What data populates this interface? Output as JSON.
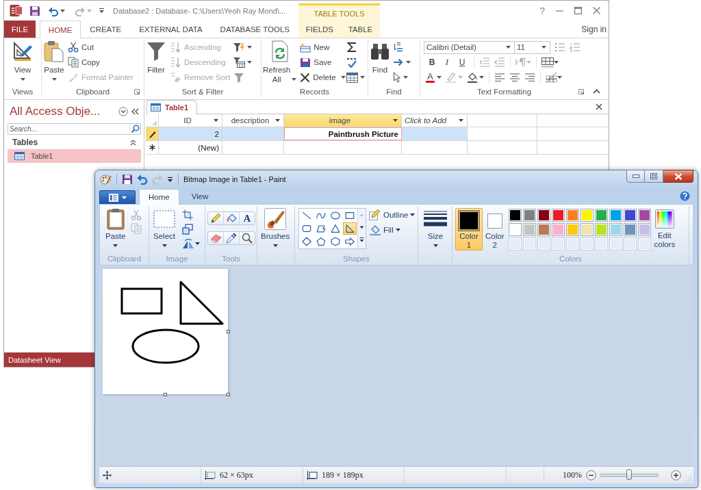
{
  "access_window": {
    "title": "Database2 : Database- C:\\Users\\Yeoh Ray Mond\\...",
    "contextual_header": "TABLE TOOLS",
    "help": "?",
    "tabs": [
      {
        "label": "FILE",
        "kind": "backstage",
        "selected": false
      },
      {
        "label": "HOME",
        "kind": "standard",
        "selected": true
      },
      {
        "label": "CREATE",
        "kind": "standard",
        "selected": false
      },
      {
        "label": "EXTERNAL DATA",
        "kind": "standard",
        "selected": false
      },
      {
        "label": "DATABASE TOOLS",
        "kind": "standard",
        "selected": false
      },
      {
        "label": "FIELDS",
        "kind": "contextual",
        "selected": false
      },
      {
        "label": "TABLE",
        "kind": "contextual",
        "selected": false
      }
    ],
    "sign_in": "Sign in",
    "ribbon": {
      "views": {
        "label": "Views",
        "view_button": "View"
      },
      "clipboard": {
        "label": "Clipboard",
        "paste_button": "Paste",
        "items": [
          {
            "label": "Cut",
            "kind": "cut",
            "disabled": false
          },
          {
            "label": "Copy",
            "kind": "copy",
            "disabled": false
          },
          {
            "label": "Format Painter",
            "kind": "format-painter",
            "disabled": true
          }
        ]
      },
      "sort_filter": {
        "label": "Sort & Filter",
        "filter_button": "Filter",
        "items": [
          {
            "label": "Ascending",
            "kind": "ascending",
            "disabled": true
          },
          {
            "label": "Descending",
            "kind": "descending",
            "disabled": true
          },
          {
            "label": "Remove Sort",
            "kind": "remove-sort",
            "disabled": true
          }
        ]
      },
      "records": {
        "label": "Records",
        "refresh_button": "Refresh All",
        "items": [
          {
            "label": "New",
            "kind": "new"
          },
          {
            "label": "Save",
            "kind": "save"
          },
          {
            "label": "Delete",
            "kind": "delete"
          }
        ]
      },
      "find": {
        "label": "Find",
        "find_button": "Find"
      },
      "text_formatting": {
        "label": "Text Formatting",
        "font": "Calibri (Detail)",
        "font_size": "11",
        "format_buttons": [
          {
            "label": "B",
            "kind": "bold"
          },
          {
            "label": "I",
            "kind": "italic"
          },
          {
            "label": "U",
            "kind": "underline"
          }
        ],
        "font_color_button": "A"
      }
    },
    "nav_pane": {
      "title": "All Access Obje...",
      "search": {
        "placeholder": "Search..."
      },
      "groups": [
        {
          "label": "Tables",
          "items": [
            {
              "label": "Table1",
              "selected": true
            }
          ]
        }
      ]
    },
    "document_tab": "Table1",
    "datasheet": {
      "columns": [
        {
          "label": "ID",
          "kind": "field",
          "selected": false
        },
        {
          "label": "description",
          "kind": "field",
          "selected": false
        },
        {
          "label": "image",
          "kind": "field",
          "selected": true
        },
        {
          "label": "Click to Add",
          "kind": "add",
          "selected": false
        }
      ],
      "rows": [
        {
          "kind": "current",
          "selected": true,
          "id": "2",
          "image": "Paintbrush Picture"
        },
        {
          "kind": "new",
          "selected": false,
          "id": "(New)"
        }
      ]
    },
    "status_bar": "Datasheet View"
  },
  "paint_window": {
    "title": "Bitmap Image in Table1 - Paint",
    "tabs": [
      {
        "label": "Home",
        "selected": true
      },
      {
        "label": "View",
        "selected": false
      }
    ],
    "ribbon": {
      "clipboard": {
        "label": "Clipboard",
        "paste_button": "Paste",
        "tools": [
          {
            "kind": "cut",
            "disabled": true
          },
          {
            "kind": "copy",
            "disabled": true
          }
        ]
      },
      "image": {
        "label": "Image",
        "select_button": "Select"
      },
      "tools": {
        "label": "Tools",
        "text_tool": "A"
      },
      "brushes_button": "Brushes",
      "shapes": {
        "label": "Shapes",
        "items": [
          {
            "kind": "line",
            "selected": false
          },
          {
            "kind": "curve",
            "selected": false
          },
          {
            "kind": "oval",
            "selected": false
          },
          {
            "kind": "rectangle",
            "selected": false
          },
          {
            "kind": "rounded-rectangle",
            "selected": false
          },
          {
            "kind": "polygon",
            "selected": false
          },
          {
            "kind": "triangle",
            "selected": false
          },
          {
            "kind": "right-triangle",
            "selected": true
          },
          {
            "kind": "diamond",
            "selected": false
          },
          {
            "kind": "pentagon",
            "selected": false
          },
          {
            "kind": "hexagon",
            "selected": false
          },
          {
            "kind": "right-arrow",
            "selected": false
          }
        ],
        "outline_button": "Outline",
        "fill_button": "Fill"
      },
      "size_button": "Size",
      "colors": {
        "label": "Colors",
        "slots": [
          {
            "label": "Color 1",
            "color": "#000000",
            "selected": true
          },
          {
            "label": "Color 2",
            "color": "#ffffff",
            "selected": false
          }
        ],
        "palette": [
          {
            "kind": "color",
            "color": "#000000"
          },
          {
            "kind": "color",
            "color": "#7f7f7f"
          },
          {
            "kind": "color",
            "color": "#880015"
          },
          {
            "kind": "color",
            "color": "#ed1c24"
          },
          {
            "kind": "color",
            "color": "#ff7f27"
          },
          {
            "kind": "color",
            "color": "#fff200"
          },
          {
            "kind": "color",
            "color": "#22b14c"
          },
          {
            "kind": "color",
            "color": "#00a2e8"
          },
          {
            "kind": "color",
            "color": "#3f48cc"
          },
          {
            "kind": "color",
            "color": "#a349a4"
          },
          {
            "kind": "color",
            "color": "#ffffff"
          },
          {
            "kind": "color",
            "color": "#c3c3c3"
          },
          {
            "kind": "color",
            "color": "#b97a57"
          },
          {
            "kind": "color",
            "color": "#ffaec9"
          },
          {
            "kind": "color",
            "color": "#ffc90e"
          },
          {
            "kind": "color",
            "color": "#efe4b0"
          },
          {
            "kind": "color",
            "color": "#b5e61d"
          },
          {
            "kind": "color",
            "color": "#99d9ea"
          },
          {
            "kind": "color",
            "color": "#7092be"
          },
          {
            "kind": "color",
            "color": "#c8bfe7"
          },
          {
            "kind": "empty"
          },
          {
            "kind": "empty"
          },
          {
            "kind": "empty"
          },
          {
            "kind": "empty"
          },
          {
            "kind": "empty"
          },
          {
            "kind": "empty"
          },
          {
            "kind": "empty"
          },
          {
            "kind": "empty"
          },
          {
            "kind": "empty"
          },
          {
            "kind": "empty"
          }
        ],
        "edit_button": "Edit colors"
      }
    },
    "status_bar": {
      "selection_size": "62 × 63px",
      "canvas_size": "189 × 189px",
      "zoom": "100%",
      "zoom_slider": {
        "level": 0.5
      }
    }
  }
}
